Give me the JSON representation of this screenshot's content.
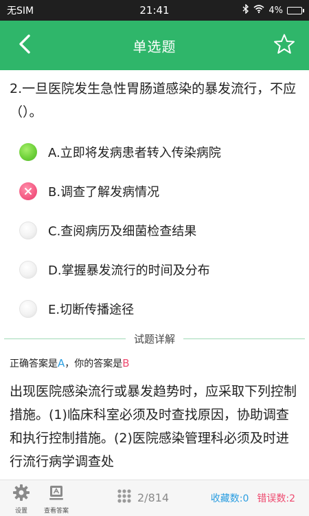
{
  "status": {
    "carrier": "无SIM",
    "time": "21:41",
    "battery": "4%"
  },
  "header": {
    "title": "单选题"
  },
  "question": {
    "text": "2.一旦医院发生急性胃肠道感染的暴发流行，不应（）。"
  },
  "options": [
    {
      "text": "A.立即将发病患者转入传染病院",
      "state": "correct"
    },
    {
      "text": "B.调查了解发病情况",
      "state": "wrong"
    },
    {
      "text": "C.查阅病历及细菌检查结果",
      "state": "empty"
    },
    {
      "text": "D.掌握暴发流行的时间及分布",
      "state": "empty"
    },
    {
      "text": "E.切断传播途径",
      "state": "empty"
    }
  ],
  "detail": {
    "section_title": "试题详解",
    "answer_prefix": "正确答案是",
    "correct_answer": "A",
    "answer_middle": "，你的答案是",
    "user_answer": "B",
    "explanation": "出现医院感染流行或暴发趋势时，应采取下列控制措施。(1)临床科室必须及时查找原因，协助调查和执行控制措施。(2)医院感染管理科必须及时进行流行病学调查处"
  },
  "bottom": {
    "settings_label": "设置",
    "view_answer_label": "查看答案",
    "progress": "2/814",
    "favorites": "收藏数:0",
    "errors": "错误数:2"
  },
  "colors": {
    "accent": "#2fb66a",
    "correct": "#2a9de0",
    "wrong": "#ee4a6f"
  },
  "icons": [
    "back-arrow-icon",
    "star-icon",
    "gear-icon",
    "answer-card-icon",
    "grid-icon",
    "wifi-icon",
    "bluetooth-icon",
    "battery-icon"
  ]
}
